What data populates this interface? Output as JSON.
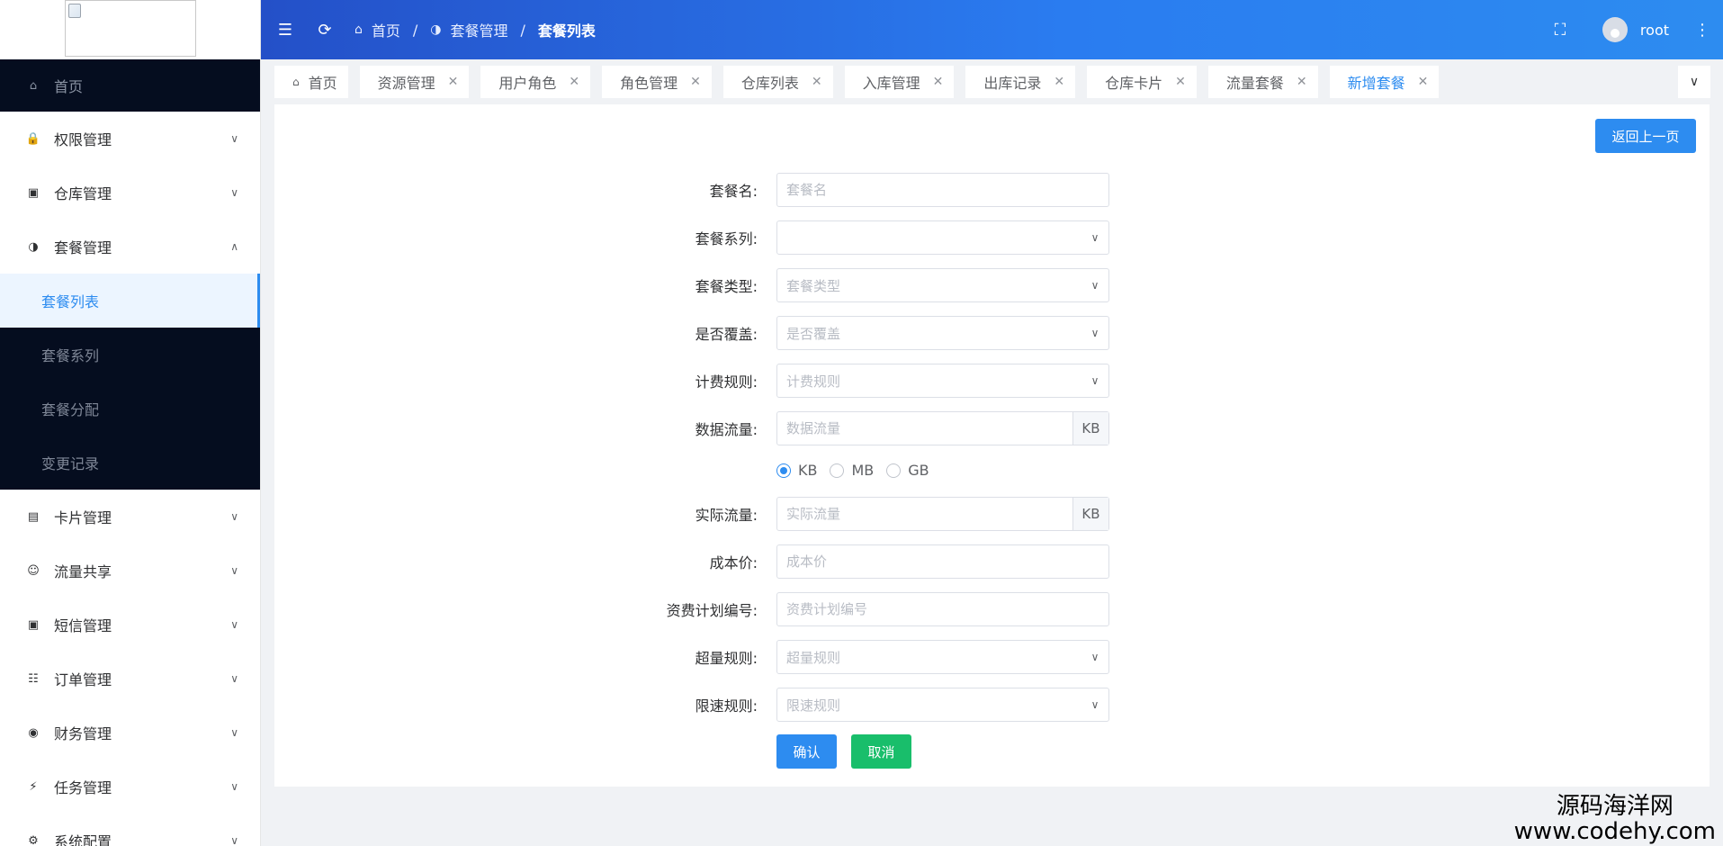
{
  "sidebar": {
    "home_label": "首页",
    "items": [
      {
        "label": "权限管理",
        "icon": "lock-icon"
      },
      {
        "label": "仓库管理",
        "icon": "cube-icon"
      },
      {
        "label": "套餐管理",
        "icon": "pie-icon",
        "expanded": true,
        "children": [
          "套餐列表",
          "套餐系列",
          "套餐分配",
          "变更记录"
        ],
        "active_child": "套餐列表"
      },
      {
        "label": "卡片管理",
        "icon": "card-icon"
      },
      {
        "label": "流量共享",
        "icon": "share-icon"
      },
      {
        "label": "短信管理",
        "icon": "message-icon"
      },
      {
        "label": "订单管理",
        "icon": "order-icon"
      },
      {
        "label": "财务管理",
        "icon": "finance-icon"
      },
      {
        "label": "任务管理",
        "icon": "task-icon"
      },
      {
        "label": "系统配置",
        "icon": "settings-icon"
      }
    ]
  },
  "header": {
    "breadcrumb": [
      "首页",
      "套餐管理",
      "套餐列表"
    ],
    "username": "root"
  },
  "tabs": [
    {
      "label": "首页",
      "closable": false
    },
    {
      "label": "资源管理",
      "closable": true
    },
    {
      "label": "用户角色",
      "closable": true
    },
    {
      "label": "角色管理",
      "closable": true
    },
    {
      "label": "仓库列表",
      "closable": true
    },
    {
      "label": "入库管理",
      "closable": true
    },
    {
      "label": "出库记录",
      "closable": true
    },
    {
      "label": "仓库卡片",
      "closable": true
    },
    {
      "label": "流量套餐",
      "closable": true
    },
    {
      "label": "新增套餐",
      "closable": true,
      "active": true
    }
  ],
  "form": {
    "back_label": "返回上一页",
    "name": {
      "label": "套餐名:",
      "placeholder": "套餐名",
      "value": ""
    },
    "series": {
      "label": "套餐系列:",
      "placeholder": "",
      "value": ""
    },
    "type": {
      "label": "套餐类型:",
      "placeholder": "套餐类型"
    },
    "overwrite": {
      "label": "是否覆盖:",
      "placeholder": "是否覆盖"
    },
    "billing": {
      "label": "计费规则:",
      "placeholder": "计费规则"
    },
    "data_flow": {
      "label": "数据流量:",
      "placeholder": "数据流量",
      "unit": "KB"
    },
    "unit_options": [
      "KB",
      "MB",
      "GB"
    ],
    "unit_selected": "KB",
    "actual_flow": {
      "label": "实际流量:",
      "placeholder": "实际流量",
      "unit": "KB"
    },
    "cost": {
      "label": "成本价:",
      "placeholder": "成本价"
    },
    "plan_no": {
      "label": "资费计划编号:",
      "placeholder": "资费计划编号"
    },
    "overage": {
      "label": "超量规则:",
      "placeholder": "超量规则"
    },
    "speed_limit": {
      "label": "限速规则:",
      "placeholder": "限速规则"
    },
    "confirm_label": "确认",
    "cancel_label": "取消"
  },
  "watermark": {
    "line1": "源码海洋网",
    "line2": "www.codehy.com"
  },
  "colors": {
    "primary": "#2d8cf0",
    "success": "#19be6b",
    "sidebar_dark": "#050d1f"
  }
}
